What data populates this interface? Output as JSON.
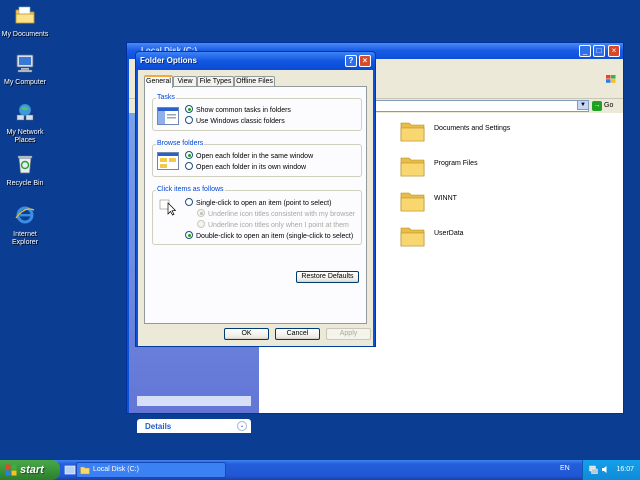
{
  "desktop": {
    "icons": [
      {
        "name": "my-documents",
        "label": "My Documents"
      },
      {
        "name": "my-computer",
        "label": "My Computer"
      },
      {
        "name": "my-network-places",
        "label": "My Network Places"
      },
      {
        "name": "recycle-bin",
        "label": "Recycle Bin"
      },
      {
        "name": "internet-explorer",
        "label": "Internet Explorer"
      }
    ]
  },
  "explorer": {
    "title": "Local Disk (C:)",
    "go_label": "Go",
    "details_label": "Details",
    "folders": [
      "Documents and Settings",
      "Program Files",
      "WINNT",
      "UserData"
    ]
  },
  "dialog": {
    "title": "Folder Options",
    "tabs": [
      "General",
      "View",
      "File Types",
      "Offline Files"
    ],
    "tasks": {
      "title": "Tasks",
      "options": [
        "Show common tasks in folders",
        "Use Windows classic folders"
      ]
    },
    "browse": {
      "title": "Browse folders",
      "options": [
        "Open each folder in the same window",
        "Open each folder in its own window"
      ]
    },
    "click": {
      "title": "Click items as follows",
      "options": [
        "Single-click to open an item (point to select)",
        "Underline icon titles consistent with my browser",
        "Underline icon titles only when I point at them",
        "Double-click to open an item (single-click to select)"
      ]
    },
    "restore_label": "Restore Defaults",
    "ok_label": "OK",
    "cancel_label": "Cancel",
    "apply_label": "Apply"
  },
  "taskbar": {
    "start_label": "start",
    "task_label": "Local Disk (C:)",
    "language": "EN",
    "clock": "16:07"
  }
}
